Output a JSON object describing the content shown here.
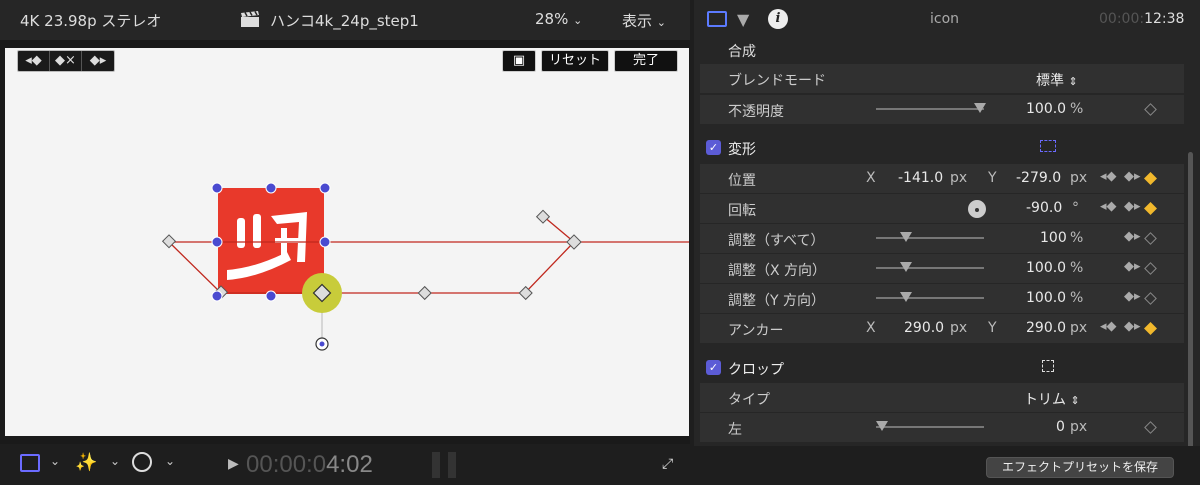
{
  "viewer": {
    "format": "4K 23.98p ステレオ",
    "project_name": "ハンコ4k_24p_step1",
    "zoom": "28%",
    "view_menu": "表示",
    "reset_button": "リセット",
    "done_button": "完了",
    "timecode_dim": "00:00:0",
    "timecode_bright": "4:02"
  },
  "inspector": {
    "clip_name": "icon",
    "duration_dim": "00:00:",
    "duration_bright": "12:38",
    "compositing": {
      "title": "合成",
      "blend_mode_label": "ブレンドモード",
      "blend_mode_value": "標準",
      "opacity_label": "不透明度",
      "opacity_value": "100.0",
      "opacity_unit": "%",
      "opacity_level": 1.0
    },
    "transform": {
      "title": "変形",
      "position_label": "位置",
      "x_label": "X",
      "y_label": "Y",
      "pos_x": "-141.0",
      "pos_y": "-279.0",
      "px": "px",
      "rotation_label": "回転",
      "rotation_value": "-90.0",
      "degree": "°",
      "scale_all_label": "調整（すべて）",
      "scale_all_value": "100",
      "scale_x_label": "調整（X 方向）",
      "scale_x_value": "100.0",
      "scale_y_label": "調整（Y 方向）",
      "scale_y_value": "100.0",
      "percent": "%",
      "anchor_label": "アンカー",
      "anchor_x": "290.0",
      "anchor_y": "290.0"
    },
    "crop": {
      "title": "クロップ",
      "type_label": "タイプ",
      "type_value": "トリム",
      "left_label": "左",
      "left_value": "0",
      "left_unit": "px"
    },
    "save_preset_button": "エフェクトプリセットを保存"
  },
  "colors": {
    "accent": "#5c5cd6",
    "keyframe_active": "#f1b82d",
    "stamp_red": "#e8392b",
    "path_red": "#c0281e",
    "handle_blue": "#4a4ad0",
    "onscreen_highlight": "#c8cc3a"
  }
}
